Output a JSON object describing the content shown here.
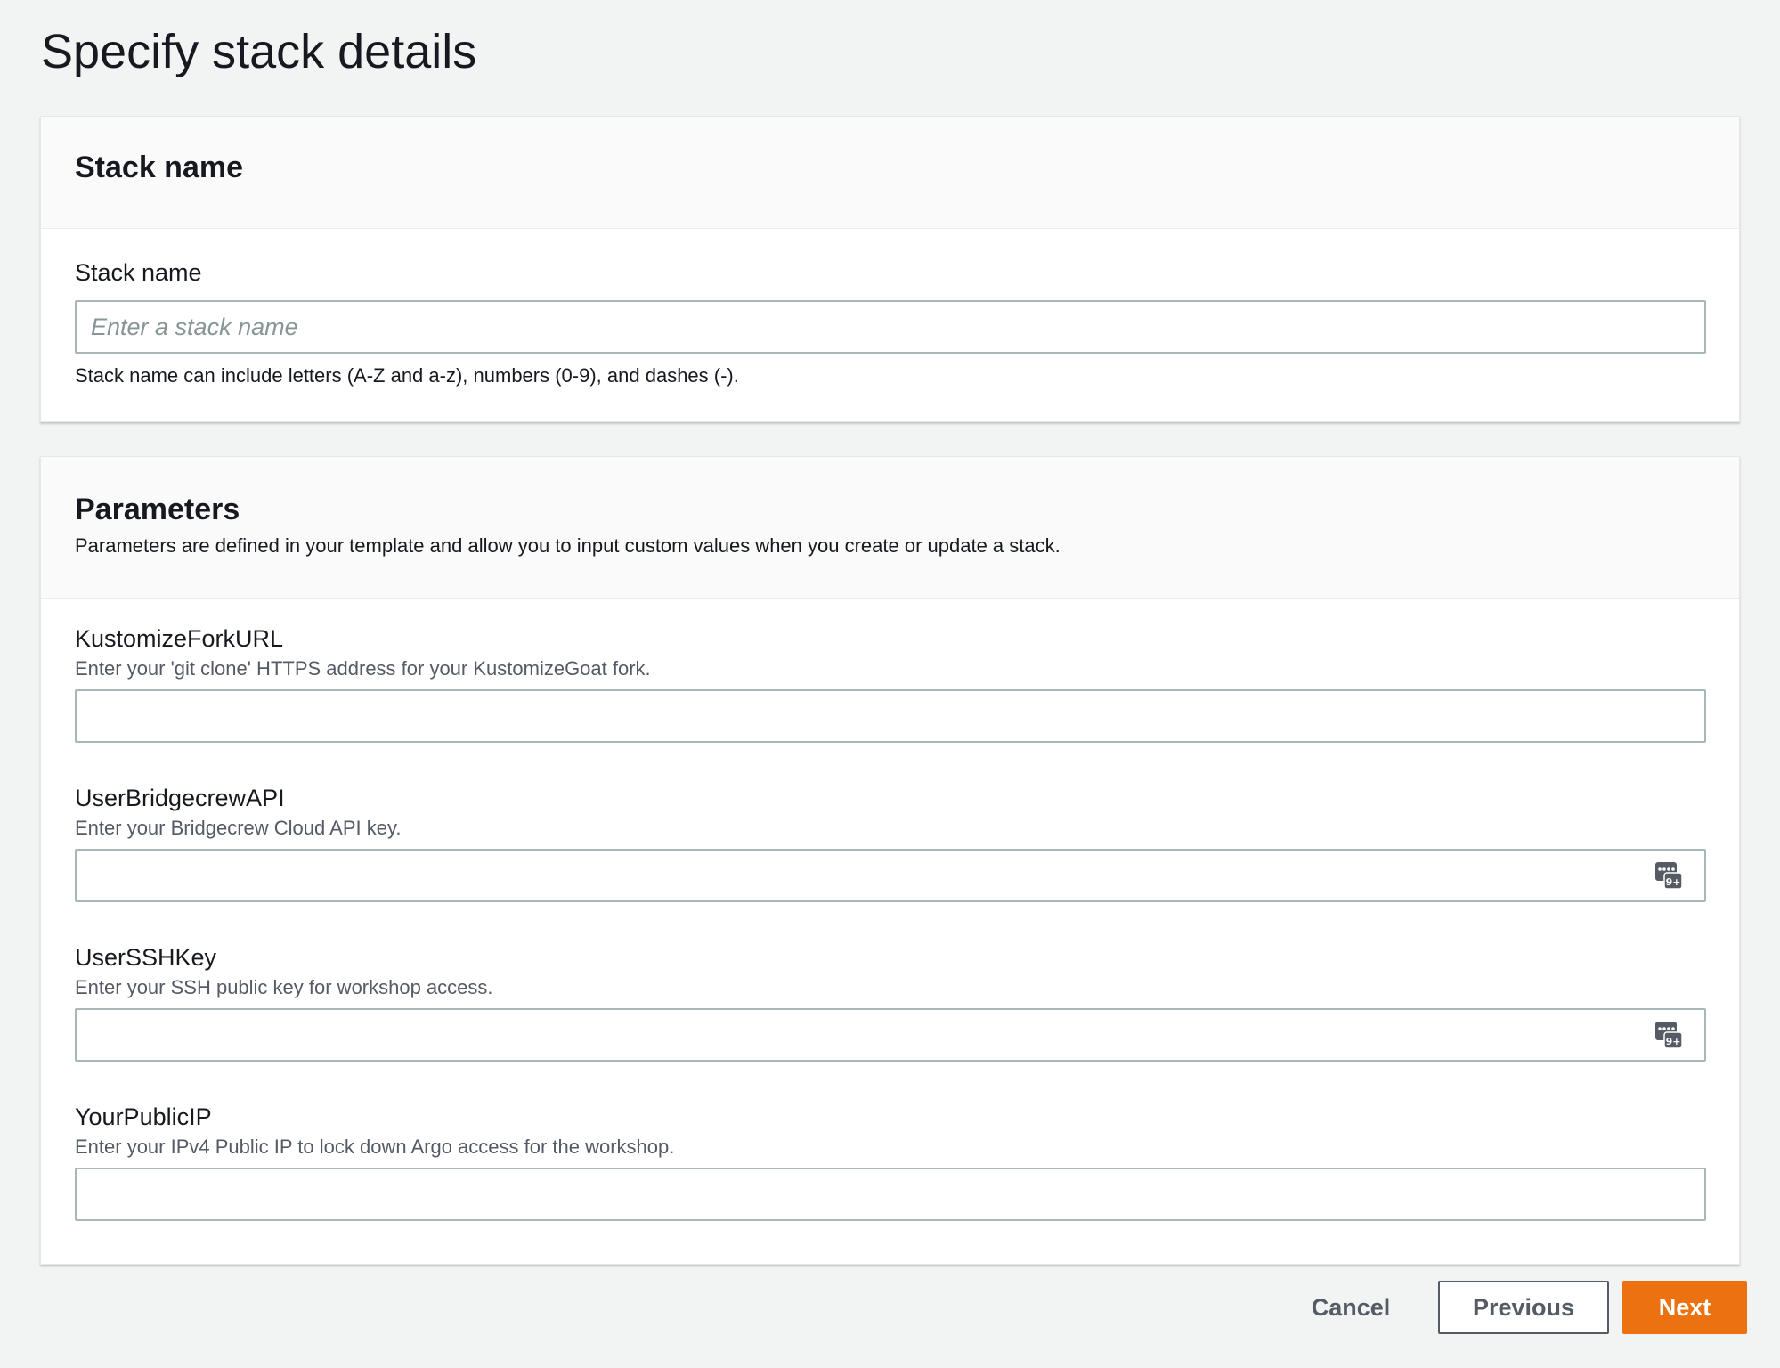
{
  "page": {
    "title": "Specify stack details"
  },
  "stack_name_panel": {
    "heading": "Stack name",
    "field": {
      "label": "Stack name",
      "placeholder": "Enter a stack name",
      "value": "",
      "constraint": "Stack name can include letters (A-Z and a-z), numbers (0-9), and dashes (-)."
    }
  },
  "parameters_panel": {
    "heading": "Parameters",
    "description": "Parameters are defined in your template and allow you to input custom values when you create or update a stack.",
    "fields": [
      {
        "label": "KustomizeForkURL",
        "description": "Enter your 'git clone' HTTPS address for your KustomizeGoat fork.",
        "value": "",
        "icon": ""
      },
      {
        "label": "UserBridgecrewAPI",
        "description": "Enter your Bridgecrew Cloud API key.",
        "value": "",
        "icon": "password-key-icon"
      },
      {
        "label": "UserSSHKey",
        "description": "Enter your SSH public key for workshop access.",
        "value": "",
        "icon": "password-key-icon"
      },
      {
        "label": "YourPublicIP",
        "description": "Enter your IPv4 Public IP to lock down Argo access for the workshop.",
        "value": "",
        "icon": ""
      }
    ]
  },
  "footer": {
    "cancel_label": "Cancel",
    "previous_label": "Previous",
    "next_label": "Next"
  },
  "colors": {
    "primary": "#ec7211",
    "background": "#f2f3f3",
    "text": "#16191f",
    "secondary_text": "#545b64",
    "input_border": "#aab7b8"
  }
}
